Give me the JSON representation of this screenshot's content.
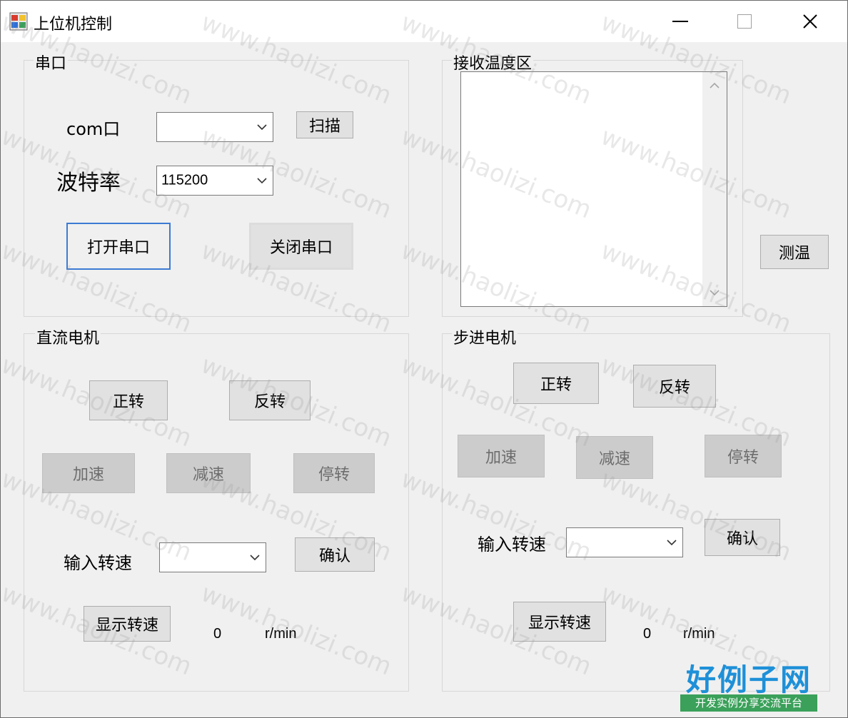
{
  "window": {
    "title": "上位机控制"
  },
  "serial": {
    "group_label": "串口",
    "com_label": "com口",
    "com_value": "",
    "scan_label": "扫描",
    "baud_label": "波特率",
    "baud_value": "115200",
    "open_label": "打开串口",
    "close_label": "关闭串口"
  },
  "temperature": {
    "group_label": "接收温度区",
    "text": "",
    "measure_label": "测温"
  },
  "dc_motor": {
    "group_label": "直流电机",
    "forward_label": "正转",
    "reverse_label": "反转",
    "accelerate_label": "加速",
    "decelerate_label": "减速",
    "stop_label": "停转",
    "speed_input_label": "输入转速",
    "speed_input_value": "",
    "confirm_label": "确认",
    "show_speed_label": "显示转速",
    "speed_value": "0",
    "speed_unit": "r/min"
  },
  "stepper_motor": {
    "group_label": "步进电机",
    "forward_label": "正转",
    "reverse_label": "反转",
    "accelerate_label": "加速",
    "decelerate_label": "减速",
    "stop_label": "停转",
    "speed_input_label": "输入转速",
    "speed_input_value": "",
    "confirm_label": "确认",
    "show_speed_label": "显示转速",
    "speed_value": "0",
    "speed_unit": "r/min"
  },
  "watermark": {
    "repeat_text": "www.haolizi.com",
    "logo_title": "好例子网",
    "logo_subtitle": "开发实例分享交流平台"
  },
  "colors": {
    "window_bg": "#f0f0f0",
    "focus_border": "#3c7bd4",
    "disabled_button": "#cccccc",
    "logo_blue": "#1e90d8",
    "logo_green": "#3aa05a"
  }
}
